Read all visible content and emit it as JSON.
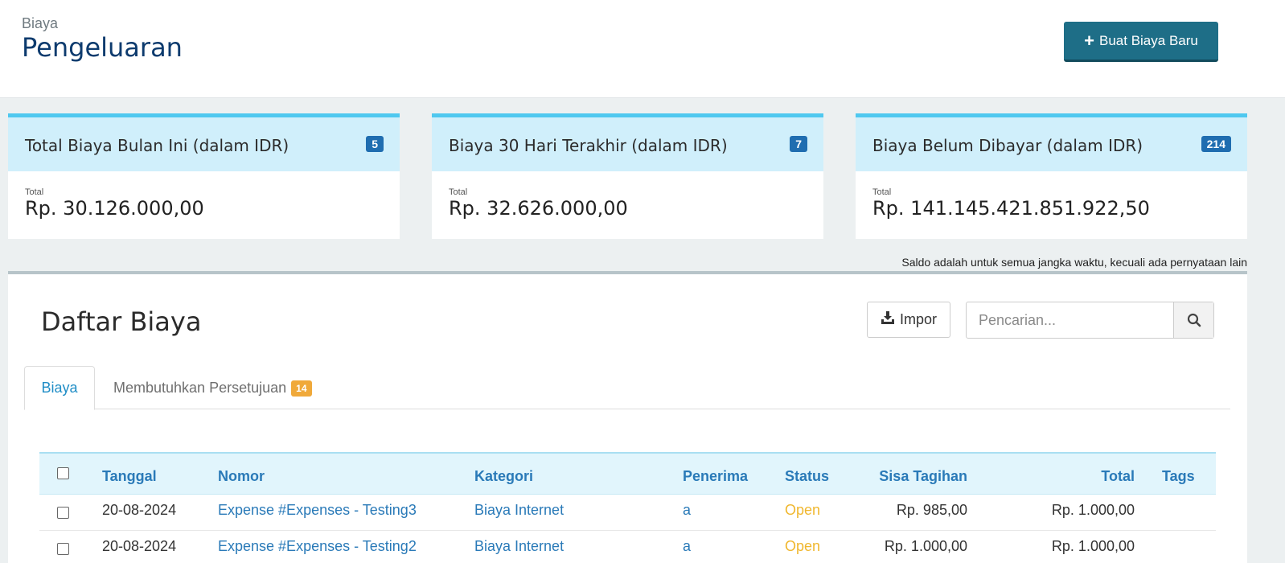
{
  "header": {
    "breadcrumb": "Biaya",
    "title": "Pengeluaran",
    "new_button_label": "Buat Biaya Baru"
  },
  "cards": [
    {
      "title": "Total Biaya Bulan Ini (dalam IDR)",
      "badge": "5",
      "total_label": "Total",
      "total_value": "Rp. 30.126.000,00"
    },
    {
      "title": "Biaya 30 Hari Terakhir (dalam IDR)",
      "badge": "7",
      "total_label": "Total",
      "total_value": "Rp. 32.626.000,00"
    },
    {
      "title": "Biaya Belum Dibayar (dalam IDR)",
      "badge": "214",
      "total_label": "Total",
      "total_value": "Rp. 141.145.421.851.922,50"
    }
  ],
  "saldo_note": "Saldo adalah untuk semua jangka waktu, kecuali ada pernyataan lain",
  "list": {
    "title": "Daftar Biaya",
    "import_label": "Impor",
    "search_placeholder": "Pencarian...",
    "tabs": [
      {
        "label": "Biaya"
      },
      {
        "label": "Membutuhkan Persetujuan",
        "badge": "14"
      }
    ],
    "columns": {
      "date": "Tanggal",
      "number": "Nomor",
      "category": "Kategori",
      "recipient": "Penerima",
      "status": "Status",
      "remaining": "Sisa Tagihan",
      "total": "Total",
      "tags": "Tags"
    },
    "rows": [
      {
        "date": "20-08-2024",
        "number": "Expense #Expenses - Testing3",
        "category": "Biaya Internet",
        "recipient": "a",
        "status": "Open",
        "remaining": "Rp. 985,00",
        "total": "Rp. 1.000,00",
        "tags": ""
      },
      {
        "date": "20-08-2024",
        "number": "Expense #Expenses - Testing2",
        "category": "Biaya Internet",
        "recipient": "a",
        "status": "Open",
        "remaining": "Rp. 1.000,00",
        "total": "Rp. 1.000,00",
        "tags": ""
      }
    ]
  }
}
